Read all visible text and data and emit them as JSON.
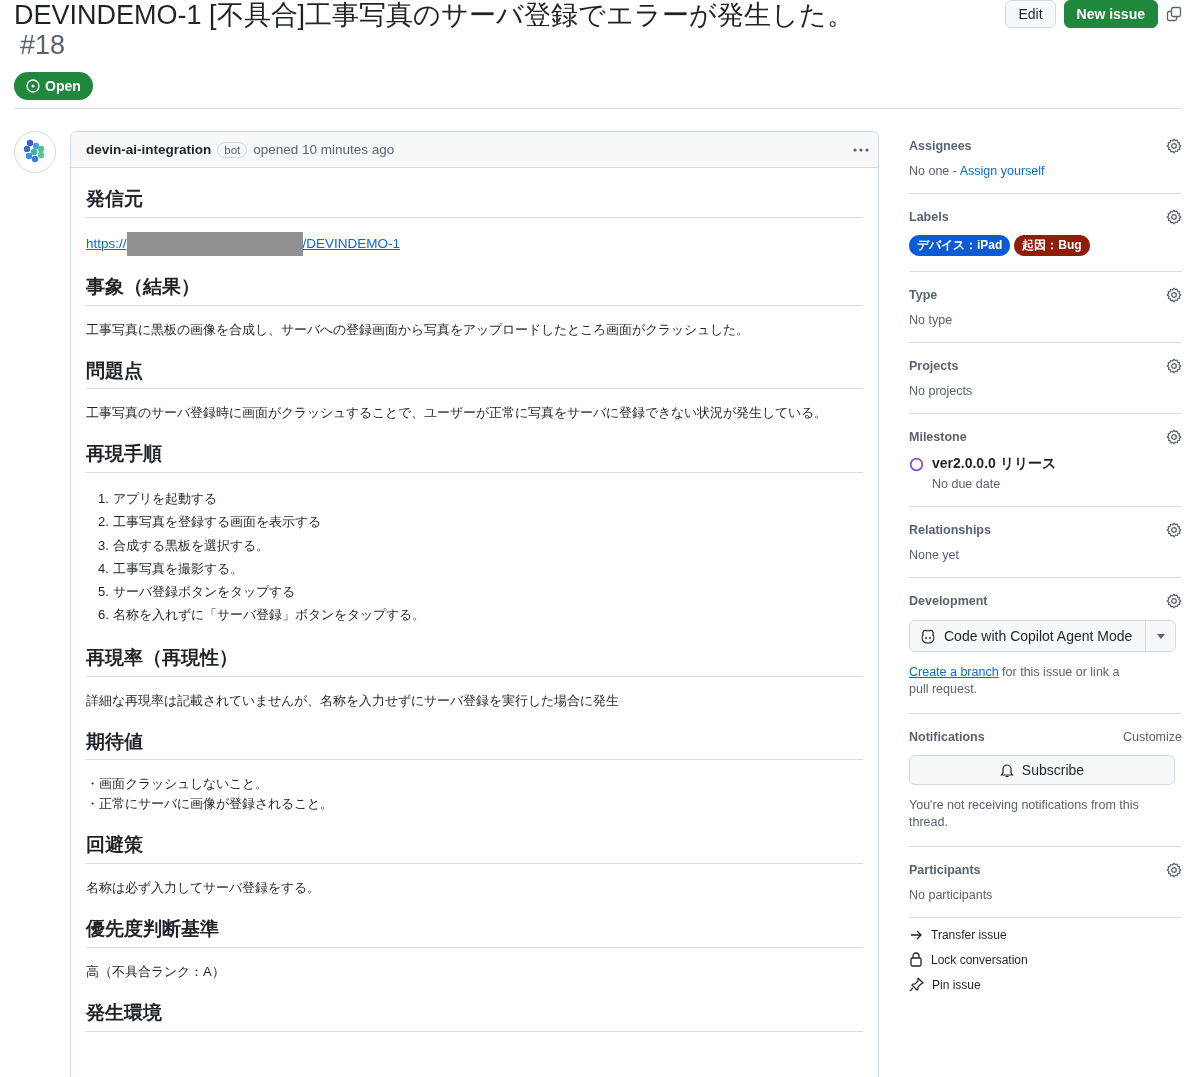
{
  "header": {
    "title": "DEVINDEMO-1 [不具合]工事写真のサーバ登録でエラーが発生した。",
    "number": "#18",
    "state": "Open",
    "buttons": [
      {
        "label": "Edit",
        "kind": "default"
      },
      {
        "label": "New issue",
        "kind": "primary"
      }
    ]
  },
  "comment": {
    "author": "devin-ai-integration",
    "badge": "bot",
    "meta": "opened 10 minutes ago",
    "sections": [
      {
        "heading": "発信元",
        "kind": "link",
        "prefix": "https://",
        "suffix": "/DEVINDEMO-1"
      },
      {
        "heading": "事象（結果）",
        "kind": "paragraph",
        "text": "工事写真に黒板の画像を合成し、サーバへの登録画面から写真をアップロードしたところ画面がクラッシュした。"
      },
      {
        "heading": "問題点",
        "kind": "paragraph",
        "text": "工事写真のサーバ登録時に画面がクラッシュすることで、ユーザーが正常に写真をサーバに登録できない状況が発生している。"
      },
      {
        "heading": "再現手順",
        "kind": "ordered",
        "items": [
          {
            "marker": "1.",
            "text": "アプリを起動する"
          },
          {
            "marker": "2.",
            "text": "工事写真を登録する画面を表示する"
          },
          {
            "marker": "3.",
            "text": "合成する黒板を選択する。"
          },
          {
            "marker": "4.",
            "text": "工事写真を撮影する。"
          },
          {
            "marker": "5.",
            "text": "サーバ登録ボタンをタップする"
          },
          {
            "marker": "6.",
            "text": "名称を入れずに「サーバ登録」ボタンをタップする。"
          }
        ]
      },
      {
        "heading": "再現率（再現性）",
        "kind": "paragraph",
        "text": "詳細な再現率は記載されていませんが、名称を入力せずにサーバ登録を実行した場合に発生"
      },
      {
        "heading": "期待値",
        "kind": "lines",
        "items": [
          "・画面クラッシュしないこと。",
          "・正常にサーバに画像が登録されること。"
        ]
      },
      {
        "heading": "回避策",
        "kind": "paragraph",
        "text": "名称は必ず入力してサーバ登録をする。"
      },
      {
        "heading": "優先度判断基準",
        "kind": "paragraph",
        "text": "高（不具合ランク：A）"
      },
      {
        "heading": "発生環境",
        "kind": "none"
      }
    ]
  },
  "sidebar": {
    "assignees": {
      "title": "Assignees",
      "text": "No one - ",
      "link": "Assign yourself"
    },
    "labels": {
      "title": "Labels",
      "items": [
        {
          "label": "デバイス：iPad",
          "color": "#0b5bd3"
        },
        {
          "label": "起因：Bug",
          "color": "#8f1d0a"
        }
      ]
    },
    "type": {
      "title": "Type",
      "text": "No type"
    },
    "projects": {
      "title": "Projects",
      "text": "No projects"
    },
    "milestone": {
      "title": "Milestone",
      "name": "ver2.0.0.0 リリース",
      "due": "No due date"
    },
    "relationships": {
      "title": "Relationships",
      "text": "None yet"
    },
    "development": {
      "title": "Development",
      "button": "Code with Copilot Agent Mode",
      "link": "Create a branch",
      "text": " for this issue or link a pull request."
    },
    "notifications": {
      "title": "Notifications",
      "customize": "Customize",
      "button": "Subscribe",
      "text": "You're not receiving notifications from this thread."
    },
    "participants": {
      "title": "Participants",
      "text": "No participants"
    },
    "actions": [
      {
        "label": "Transfer issue",
        "kind": "arrow"
      },
      {
        "label": "Lock conversation",
        "kind": "lock"
      },
      {
        "label": "Pin issue",
        "kind": "pin"
      }
    ]
  }
}
